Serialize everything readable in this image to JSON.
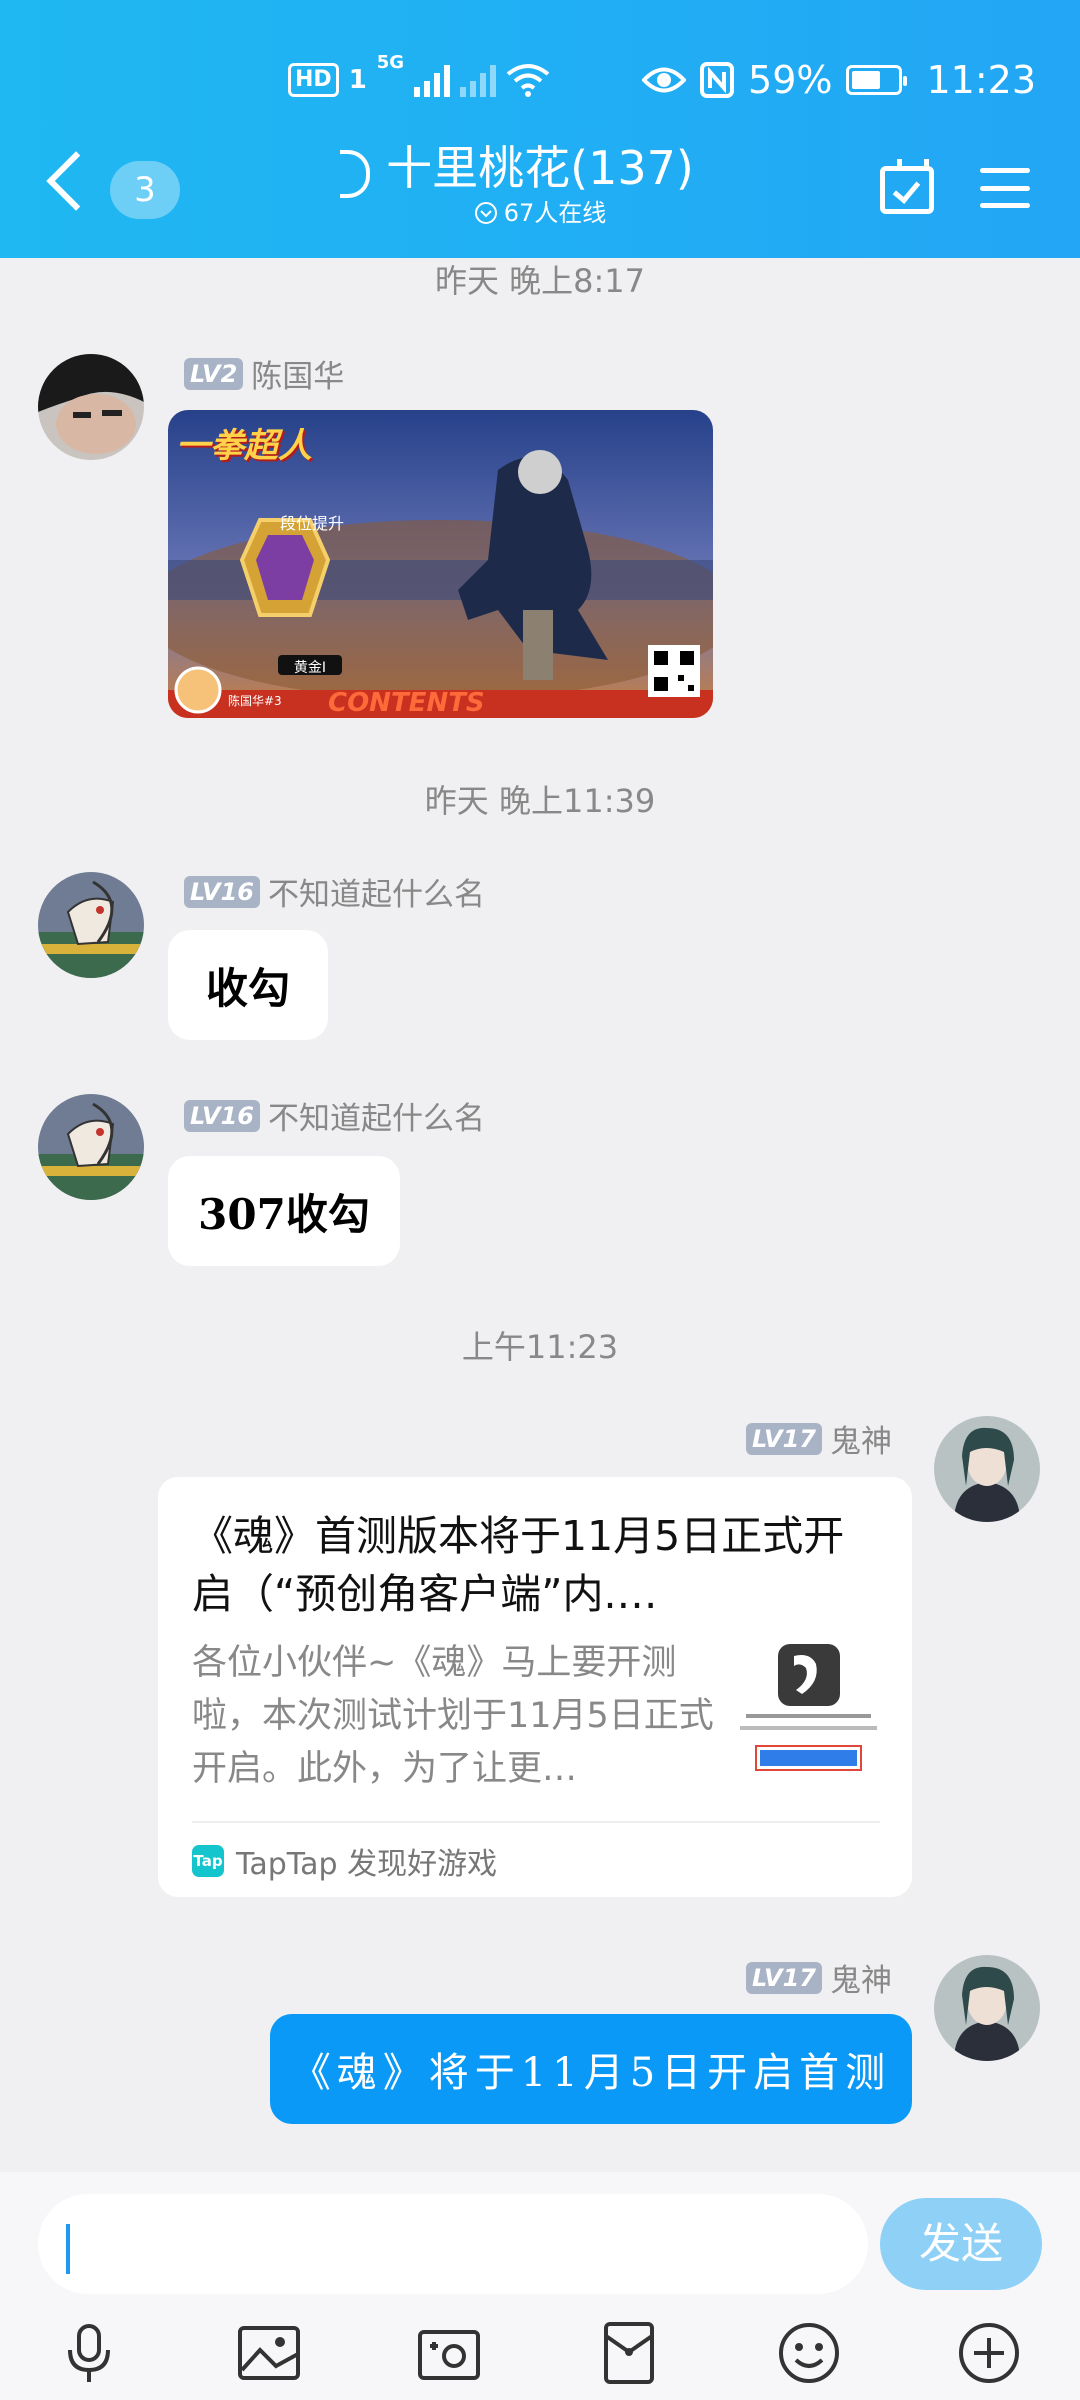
{
  "status_bar": {
    "hd": "HD",
    "sim": "1",
    "network": "5G",
    "battery": "59%",
    "clock": "11:23"
  },
  "header": {
    "unread_count": "3",
    "group_title": "十里桃花(137)",
    "online_text": "67人在线"
  },
  "timestamps": [
    "昨天 晚上8:17",
    "昨天 晚上11:39",
    "上午11:23"
  ],
  "messages": [
    {
      "level": "LV2",
      "name": "陈国华",
      "type": "image"
    },
    {
      "level": "LV16",
      "name": "不知道起什么名",
      "text": "收勾"
    },
    {
      "level": "LV16",
      "name": "不知道起什么名",
      "text": "307收勾"
    },
    {
      "level": "LV17",
      "name": "鬼神",
      "type": "link",
      "link_title": "《魂》首测版本将于11月5日正式开启（“预创角客户端”内.…",
      "link_desc": "各位小伙伴~《魂》马上要开测啦，本次测试计划于11月5日正式开启。此外，为了让更…",
      "link_source": "TapTap 发现好游戏",
      "tap_icon": "Tap"
    },
    {
      "level": "LV17",
      "name": "鬼神",
      "text": "《魂》将于11月5日开启首测"
    }
  ],
  "image_card": {
    "logo": "一拳超人",
    "rank_text": "段位提升",
    "rank_name": "黄金I",
    "player": "陈国华#3",
    "banner": "CONTENTS"
  },
  "composer": {
    "send_label": "发送"
  },
  "colors": {
    "header": "#1fb8f2",
    "bubble_self": "#0a99f6",
    "send_button": "#8fd0f7",
    "background": "#f0f0f2"
  },
  "toolbar_icons": [
    "microphone-icon",
    "image-icon",
    "camera-icon",
    "red-packet-icon",
    "emoji-icon",
    "plus-icon"
  ]
}
